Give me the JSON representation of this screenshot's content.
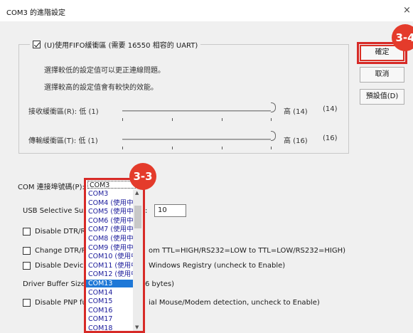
{
  "window": {
    "title": "COM3 的進階設定",
    "close_glyph": "×"
  },
  "fifo_group": {
    "checkbox_label": "(U)使用FIFO緩衝區 (需要 16550 相容的 UART)",
    "checked": true,
    "hint1": "選擇較低的設定值可以更正連線問題。",
    "hint2": "選擇較高的設定值會有較快的效能。",
    "receive": {
      "label": "接收緩衝區(R): 低 (1)",
      "high_label": "高 (14)",
      "value": "(14)"
    },
    "transmit": {
      "label": "傳輸緩衝區(T): 低 (1)",
      "high_label": "高 (16)",
      "value": "(16)"
    }
  },
  "buttons": {
    "ok": "確定",
    "cancel": "取消",
    "defaults": "預設值(D)"
  },
  "com_port": {
    "label": "COM 連接埠號碼(P):",
    "selected": "COM3",
    "options": [
      "COM3",
      "COM4 (使用中",
      "COM5 (使用中",
      "COM6 (使用中",
      "COM7 (使用中",
      "COM8 (使用中",
      "COM9 (使用中",
      "COM10 (使用中",
      "COM11 (使用中",
      "COM12 (使用中",
      "COM13",
      "COM14",
      "COM15",
      "COM16",
      "COM17",
      "COM18"
    ],
    "highlighted": "COM13"
  },
  "usb_suspend": {
    "label": "USB Selective Suspe",
    "colon": ":",
    "value": "10"
  },
  "options": {
    "disable_dtr": "Disable DTR/RTS",
    "change_dtr": "Change DTR/RTS",
    "change_dtr_rest": "om TTL=HIGH/RS232=LOW to TTL=LOW/RS232=HIGH)",
    "disable_device": "Disable Device U",
    "disable_device_rest": "Windows Registry (uncheck to Enable)",
    "driver_buffer": "Driver Buffer Size:",
    "driver_buffer_rest": "6 bytes)",
    "disable_pnp": "Disable PNP func",
    "disable_pnp_rest": "ial Mouse/Modem detection, uncheck to Enable)"
  },
  "badges": {
    "b1": "3-3",
    "b2": "3-4"
  },
  "colors": {
    "annotation_red": "#d72a27",
    "selection_blue": "#1e78d7"
  }
}
